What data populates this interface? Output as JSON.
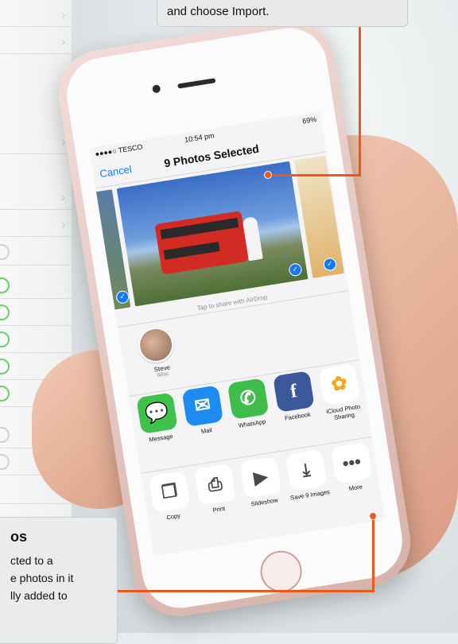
{
  "callout_top": {
    "text": "and choose Import."
  },
  "callout_bottom": {
    "heading": "os",
    "lines": [
      "cted to a",
      "e photos in it",
      "lly added to"
    ]
  },
  "status": {
    "carrier": "●●●●○ TESCO",
    "time": "10:54 pm",
    "battery": "69%"
  },
  "share_sheet": {
    "cancel": "Cancel",
    "title": "9 Photos Selected",
    "airdrop_hint": "Tap to share with AirDrop",
    "contact": {
      "name": "Steve",
      "device": "iMac"
    },
    "apps": [
      {
        "label": "Message",
        "icon": "message-icon",
        "color": "#3fc24a"
      },
      {
        "label": "Mail",
        "icon": "mail-icon",
        "color": "#1d8cf0"
      },
      {
        "label": "WhatsApp",
        "icon": "whatsapp-icon",
        "color": "#3ebd4a"
      },
      {
        "label": "Facebook",
        "icon": "facebook-icon",
        "color": "#3b5998"
      },
      {
        "label": "iCloud Photo Sharing",
        "icon": "photos-icon",
        "color": "#ffffff"
      }
    ],
    "actions": [
      {
        "label": "Copy",
        "icon": "copy-icon"
      },
      {
        "label": "Print",
        "icon": "print-icon"
      },
      {
        "label": "Slideshow",
        "icon": "play-icon"
      },
      {
        "label": "Save 9 Images",
        "icon": "save-image-icon"
      },
      {
        "label": "More",
        "icon": "more-icon"
      }
    ]
  }
}
